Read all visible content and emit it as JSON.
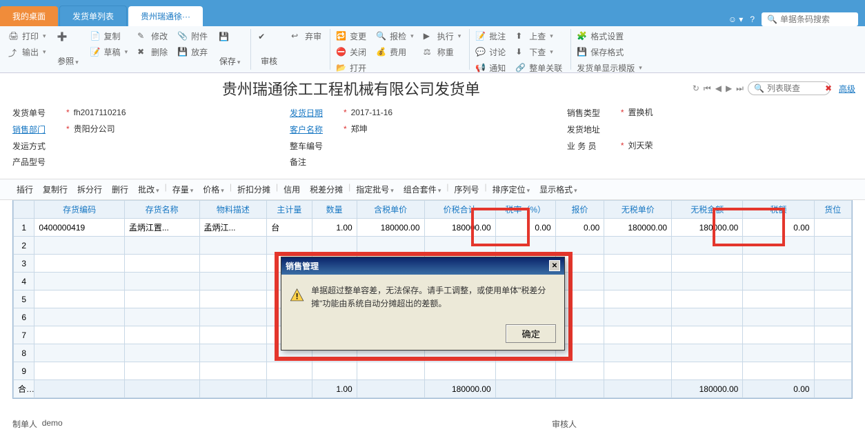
{
  "top": {
    "tabs": [
      "我的桌面",
      "发货单列表",
      "贵州瑞通徐···"
    ],
    "search_placeholder": "单据条码搜索"
  },
  "ribbon": {
    "print": "打印",
    "output": "输出",
    "ref": "参照",
    "copy": "复制",
    "draft": "草稿",
    "delete": "删除",
    "edit": "修改",
    "attach": "附件",
    "abandon": "放弃",
    "save": "保存",
    "audit": "审核",
    "unaudit": "弃审",
    "change": "变更",
    "close": "关闭",
    "open": "打开",
    "check": "报检",
    "cost": "费用",
    "exec": "执行",
    "weigh": "称重",
    "approve": "批注",
    "discuss": "讨论",
    "notify": "通知",
    "up": "上查",
    "down": "下查",
    "relate": "整单关联",
    "fmt": "格式设置",
    "savefmt": "保存格式",
    "tpl": "发货单显示模版"
  },
  "doc": {
    "title": "贵州瑞通徐工工程机械有限公司发货单",
    "nav_search_placeholder": "列表联查",
    "adv": "高级"
  },
  "form": {
    "l_no": "发货单号",
    "v_no": "fh2017110216",
    "l_date": "发货日期",
    "v_date": "2017-11-16",
    "l_type": "销售类型",
    "v_type": "置换机",
    "l_dept": "销售部门",
    "v_dept": "贵阳分公司",
    "l_cust": "客户名称",
    "v_cust": "郑坤",
    "l_addr": "发货地址",
    "v_addr": "",
    "l_ship": "发运方式",
    "v_ship": "",
    "l_car": "整车编号",
    "v_car": "",
    "l_emp": "业 务 员",
    "v_emp": "刘天荣",
    "l_model": "产品型号",
    "v_model": "",
    "l_remark": "备注",
    "v_remark": ""
  },
  "tbar": [
    "插行",
    "复制行",
    "拆分行",
    "删行",
    "批改",
    "|",
    "存量",
    "价格",
    "|",
    "折扣分摊",
    "|",
    "信用",
    "税差分摊",
    "|",
    "指定批号",
    "组合套件",
    "|",
    "序列号",
    "|",
    "排序定位",
    "显示格式"
  ],
  "grid": {
    "headers": [
      "",
      "存货编码",
      "存货名称",
      "物料描述",
      "主计量",
      "数量",
      "含税单价",
      "价税合计",
      "税率（%）",
      "报价",
      "无税单价",
      "无税金额",
      "税额",
      "货位"
    ],
    "rows": [
      {
        "n": "1",
        "code": "0400000419",
        "name": "孟炳江置...",
        "desc": "孟炳江...",
        "uom": "台",
        "qty": "1.00",
        "pti": "180000.00",
        "tot": "180000.00",
        "rate": "0.00",
        "quote": "0.00",
        "pnt": "180000.00",
        "ant": "180000.00",
        "tax": "0.00",
        "loc": ""
      }
    ],
    "total_label": "合计",
    "totals": {
      "qty": "1.00",
      "tot": "180000.00",
      "ant": "180000.00",
      "tax": "0.00"
    }
  },
  "dialog": {
    "title": "销售管理",
    "msg": "单据超过整单容差，无法保存。请手工调整，或使用单体\"税差分摊\"功能由系统自动分摊超出的差额。",
    "ok": "确定"
  },
  "footer": {
    "maker_l": "制单人",
    "maker_v": "demo",
    "auditor_l": "审核人"
  }
}
